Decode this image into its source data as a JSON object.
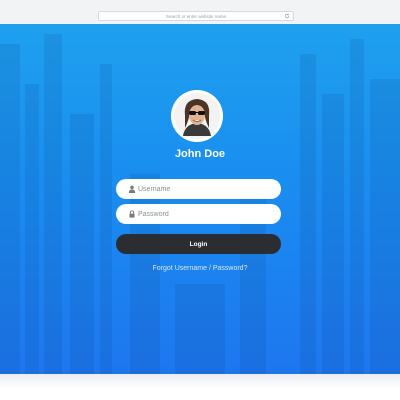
{
  "browser": {
    "address_placeholder": "Search or enter website name"
  },
  "colors": {
    "background_top": "#1fa0ee",
    "background_bottom": "#1e76ef",
    "button": "#2a2e33"
  },
  "profile": {
    "name": "John Doe",
    "avatar_icon": "user-photo"
  },
  "form": {
    "username": {
      "placeholder": "Username",
      "value": "",
      "icon": "user-icon"
    },
    "password": {
      "placeholder": "Password",
      "value": "",
      "icon": "lock-icon"
    },
    "login_label": "Login",
    "forgot_label": "Forgot Username / Password?"
  }
}
